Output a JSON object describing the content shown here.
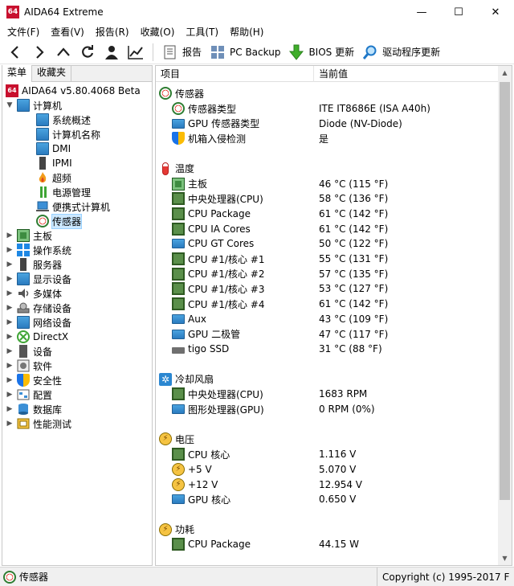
{
  "window": {
    "app_icon_text": "64",
    "title": "AIDA64 Extreme",
    "minimize": "—",
    "maximize": "☐",
    "close": "✕"
  },
  "menu": [
    "文件(F)",
    "查看(V)",
    "报告(R)",
    "收藏(O)",
    "工具(T)",
    "帮助(H)"
  ],
  "toolbar": {
    "report": "报告",
    "pc_backup": "PC Backup",
    "bios_update": "BIOS 更新",
    "driver_update": "驱动程序更新"
  },
  "left": {
    "tabs": [
      "菜单",
      "收藏夹"
    ],
    "root": "AIDA64 v5.80.4068 Beta",
    "computer": "计算机",
    "computer_children": [
      "系统概述",
      "计算机名称",
      "DMI",
      "IPMI",
      "超频",
      "电源管理",
      "便携式计算机",
      "传感器"
    ],
    "categories": [
      "主板",
      "操作系统",
      "服务器",
      "显示设备",
      "多媒体",
      "存储设备",
      "网络设备",
      "DirectX",
      "设备",
      "软件",
      "安全性",
      "配置",
      "数据库",
      "性能测试"
    ]
  },
  "right": {
    "col_item": "项目",
    "col_value": "当前值",
    "sections": [
      {
        "title": "传感器",
        "icon": "gauge-icon",
        "items": [
          {
            "name": "传感器类型",
            "value": "ITE IT8686E  (ISA A40h)",
            "icon": "gauge-icon"
          },
          {
            "name": "GPU 传感器类型",
            "value": "Diode  (NV-Diode)",
            "icon": "monitor-icon"
          },
          {
            "name": "机箱入侵检测",
            "value": "是",
            "icon": "shield-icon"
          }
        ]
      },
      {
        "title": "温度",
        "icon": "thermometer-icon",
        "items": [
          {
            "name": "主板",
            "value": "46 °C  (115 °F)",
            "icon": "motherboard-icon"
          },
          {
            "name": "中央处理器(CPU)",
            "value": "58 °C  (136 °F)",
            "icon": "cpu-icon"
          },
          {
            "name": "CPU Package",
            "value": "61 °C  (142 °F)",
            "icon": "cpu-icon"
          },
          {
            "name": "CPU IA Cores",
            "value": "61 °C  (142 °F)",
            "icon": "cpu-icon"
          },
          {
            "name": "CPU GT Cores",
            "value": "50 °C  (122 °F)",
            "icon": "monitor-icon"
          },
          {
            "name": "CPU #1/核心 #1",
            "value": "55 °C  (131 °F)",
            "icon": "cpu-icon"
          },
          {
            "name": "CPU #1/核心 #2",
            "value": "57 °C  (135 °F)",
            "icon": "cpu-icon"
          },
          {
            "name": "CPU #1/核心 #3",
            "value": "53 °C  (127 °F)",
            "icon": "cpu-icon"
          },
          {
            "name": "CPU #1/核心 #4",
            "value": "61 °C  (142 °F)",
            "icon": "cpu-icon"
          },
          {
            "name": "Aux",
            "value": "43 °C  (109 °F)",
            "icon": "monitor-icon"
          },
          {
            "name": "GPU 二极管",
            "value": "47 °C  (117 °F)",
            "icon": "monitor-icon"
          },
          {
            "name": "tigo SSD",
            "value": "31 °C  (88 °F)",
            "icon": "ssd-icon"
          }
        ]
      },
      {
        "title": "冷却风扇",
        "icon": "fan-icon",
        "items": [
          {
            "name": "中央处理器(CPU)",
            "value": "1683 RPM",
            "icon": "cpu-icon"
          },
          {
            "name": "图形处理器(GPU)",
            "value": "0 RPM  (0%)",
            "icon": "monitor-icon"
          }
        ]
      },
      {
        "title": "电压",
        "icon": "voltage-icon",
        "items": [
          {
            "name": "CPU 核心",
            "value": "1.116 V",
            "icon": "cpu-icon"
          },
          {
            "name": "+5 V",
            "value": "5.070 V",
            "icon": "voltage-icon"
          },
          {
            "name": "+12 V",
            "value": "12.954 V",
            "icon": "voltage-icon"
          },
          {
            "name": "GPU 核心",
            "value": "0.650 V",
            "icon": "monitor-icon"
          }
        ]
      },
      {
        "title": "功耗",
        "icon": "voltage-icon",
        "items": [
          {
            "name": "CPU Package",
            "value": "44.15 W",
            "icon": "cpu-icon"
          }
        ]
      }
    ]
  },
  "status": {
    "left": "传感器",
    "right": "Copyright (c) 1995-2017 F"
  }
}
